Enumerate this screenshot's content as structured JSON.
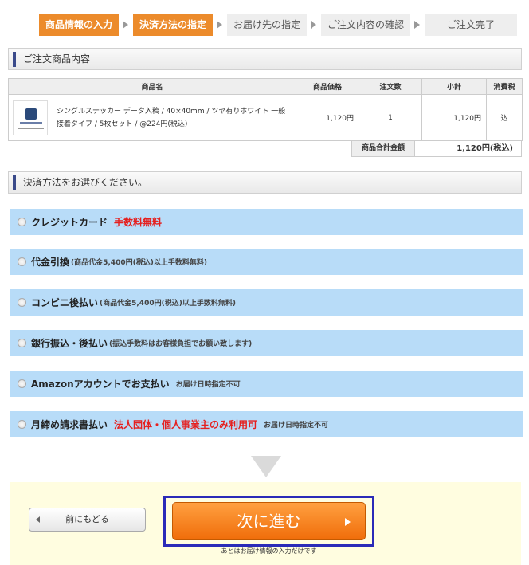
{
  "steps": [
    {
      "label": "商品情報の入力",
      "active": true
    },
    {
      "label": "決済方法の指定",
      "active": true
    },
    {
      "label": "お届け先の指定",
      "active": false
    },
    {
      "label": "ご注文内容の確認",
      "active": false
    },
    {
      "label": "ご注文完了",
      "active": false
    }
  ],
  "order_section": {
    "title": "ご注文商品内容"
  },
  "cart": {
    "headers": [
      "商品名",
      "商品価格",
      "注文数",
      "小計",
      "消費税"
    ],
    "rows": [
      {
        "name": "シングルステッカー データ入稿 / 40×40mm / ツヤ有りホワイト 一般接着タイプ / 5枚セット / @224円(税込)",
        "price": "1,120円",
        "qty": "1",
        "subtotal": "1,120円",
        "tax": "込"
      }
    ],
    "total_label": "商品合計金額",
    "total_value": "1,120円(税込)"
  },
  "payment_section": {
    "title": "決済方法をお選びください。"
  },
  "payment_options": [
    {
      "label": "クレジットカード",
      "red": "手数料無料"
    },
    {
      "label": "代金引換",
      "sub": "(商品代金5,400円(税込)以上手数料無料)"
    },
    {
      "label": "コンビニ後払い",
      "sub": "(商品代金5,400円(税込)以上手数料無料)"
    },
    {
      "label": "銀行振込・後払い",
      "sub": "(振込手数料はお客様負担でお願い致します)"
    },
    {
      "label": "Amazonアカウントでお支払い",
      "note": "お届け日時指定不可"
    },
    {
      "label": "月締め請求書払い",
      "red": "法人団体・個人事業主のみ利用可",
      "note": "お届け日時指定不可"
    }
  ],
  "buttons": {
    "back": "前にもどる",
    "next": "次に進む",
    "next_note": "あとはお届け情報の入力だけです"
  },
  "colors": {
    "accent": "#ec8b2b",
    "option_bg": "#b8dcf8",
    "next_button": "#f47a1a"
  }
}
